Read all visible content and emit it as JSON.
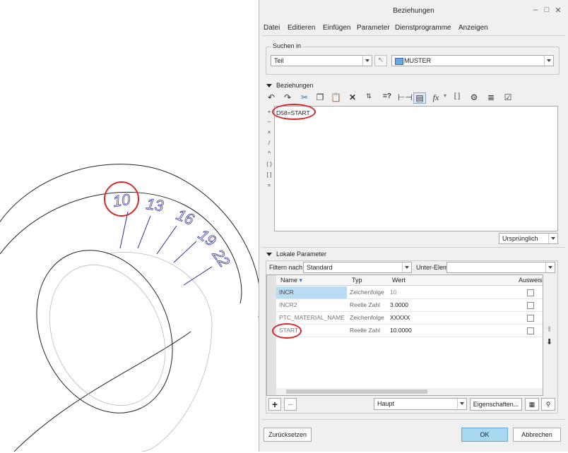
{
  "cad": {
    "numbers": [
      "10",
      "13",
      "16",
      "19",
      "22"
    ]
  },
  "dialog": {
    "title": "Beziehungen",
    "window_controls": {
      "minimize": "–",
      "maximize": "□",
      "close": "✕"
    },
    "menu": [
      "Datei",
      "Editieren",
      "Einfügen",
      "Parameter",
      "Dienstprogramme",
      "Anzeigen"
    ],
    "search": {
      "group_label": "Suchen in",
      "type_value": "Teil",
      "model_value": "MUSTER"
    },
    "relations": {
      "section_label": "Beziehungen",
      "text": "D58=START",
      "operators": [
        "+",
        "–",
        "×",
        "/",
        "^",
        "( )",
        "[ ]",
        "="
      ],
      "units_value": "Ursprünglich"
    },
    "toolbar": {
      "fx_label": "fx",
      "eq_label": "=?",
      "brackets_label": "[ ]"
    },
    "local_params": {
      "section_label": "Lokale Parameter",
      "filter_label": "Filtern nach",
      "filter_value": "Standard",
      "sub_label": "Unter-Elem",
      "columns": [
        "Name",
        "Typ",
        "Wert",
        "Ausweise"
      ],
      "rows": [
        {
          "name": "INCR",
          "type": "Zeichenfolge",
          "value": "10",
          "checked": false
        },
        {
          "name": "INCR2",
          "type": "Reelle Zahl",
          "value": "3.0000",
          "checked": false
        },
        {
          "name": "PTC_MATERIAL_NAME",
          "type": "Zeichenfolge",
          "value": "XXXXX",
          "checked": false
        },
        {
          "name": "START",
          "type": "Reelle Zahl",
          "value": "10.0000",
          "checked": false
        }
      ],
      "main_value": "Haupt",
      "properties_label": "Eigenschaften..."
    },
    "footer": {
      "reset_label": "Zurücksetzen",
      "ok_label": "OK",
      "cancel_label": "Abbrechen"
    },
    "colors": {
      "ok_button": "#a8d8f0",
      "selected_cell": "#b8dcf4",
      "highlight": "#d8262a"
    }
  }
}
